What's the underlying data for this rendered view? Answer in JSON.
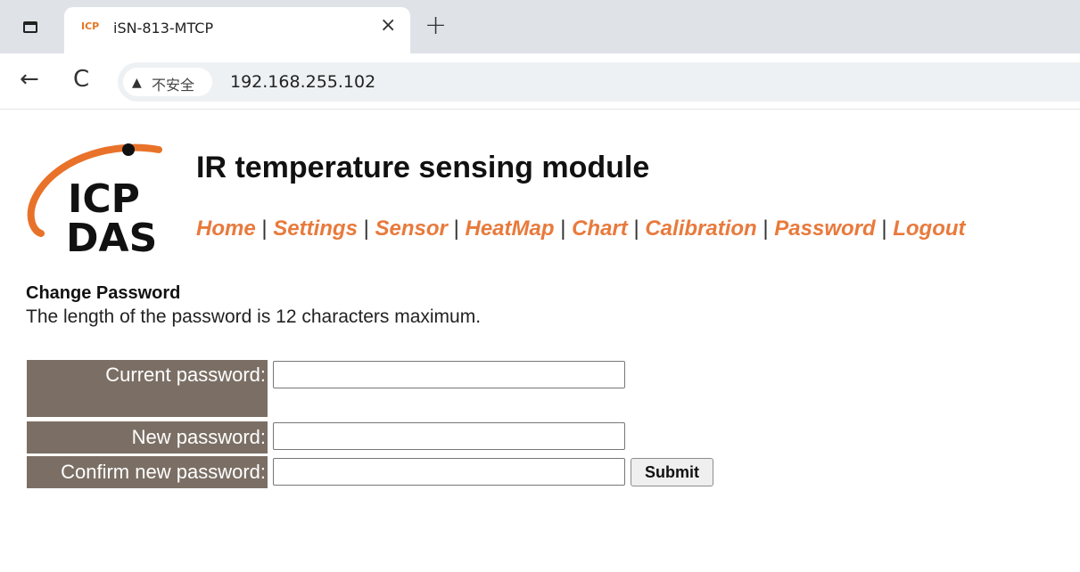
{
  "browser": {
    "tab_title": "iSN-813-MTCP",
    "tab_favicon_text": "ICP",
    "close_glyph": "×",
    "new_tab_glyph": "+",
    "back_glyph": "←",
    "reload_glyph": "C",
    "security_label": "不安全",
    "warning_glyph": "▲",
    "url": "192.168.255.102"
  },
  "logo": {
    "line1": "ICP",
    "line2": "DAS",
    "accent_color": "#e8722a"
  },
  "page": {
    "title": "IR temperature sensing module",
    "nav": [
      {
        "label": "Home"
      },
      {
        "label": "Settings"
      },
      {
        "label": "Sensor"
      },
      {
        "label": "HeatMap"
      },
      {
        "label": "Chart"
      },
      {
        "label": "Calibration"
      },
      {
        "label": "Password"
      },
      {
        "label": "Logout"
      }
    ],
    "separator": "|",
    "link_color": "#e87a3c",
    "section_heading": "Change Password",
    "section_note": "The length of the password is 12 characters maximum."
  },
  "form": {
    "label_bg": "#7b6f65",
    "current_label": "Current password:",
    "new_label": "New password:",
    "confirm_label": "Confirm new password:",
    "current_value": "",
    "new_value": "",
    "confirm_value": "",
    "submit_label": "Submit"
  }
}
